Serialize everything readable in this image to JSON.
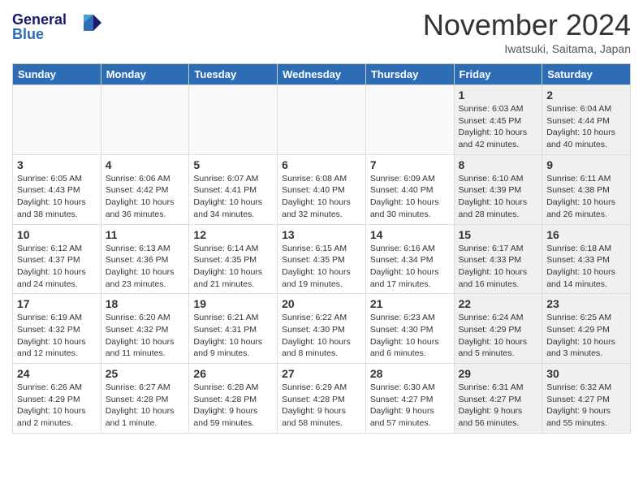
{
  "header": {
    "logo_line1": "General",
    "logo_line2": "Blue",
    "month_title": "November 2024",
    "location": "Iwatsuki, Saitama, Japan"
  },
  "days_of_week": [
    "Sunday",
    "Monday",
    "Tuesday",
    "Wednesday",
    "Thursday",
    "Friday",
    "Saturday"
  ],
  "weeks": [
    [
      {
        "num": "",
        "info": "",
        "empty": true
      },
      {
        "num": "",
        "info": "",
        "empty": true
      },
      {
        "num": "",
        "info": "",
        "empty": true
      },
      {
        "num": "",
        "info": "",
        "empty": true
      },
      {
        "num": "",
        "info": "",
        "empty": true
      },
      {
        "num": "1",
        "info": "Sunrise: 6:03 AM\nSunset: 4:45 PM\nDaylight: 10 hours and 42 minutes.",
        "shaded": true
      },
      {
        "num": "2",
        "info": "Sunrise: 6:04 AM\nSunset: 4:44 PM\nDaylight: 10 hours and 40 minutes.",
        "shaded": true
      }
    ],
    [
      {
        "num": "3",
        "info": "Sunrise: 6:05 AM\nSunset: 4:43 PM\nDaylight: 10 hours and 38 minutes."
      },
      {
        "num": "4",
        "info": "Sunrise: 6:06 AM\nSunset: 4:42 PM\nDaylight: 10 hours and 36 minutes."
      },
      {
        "num": "5",
        "info": "Sunrise: 6:07 AM\nSunset: 4:41 PM\nDaylight: 10 hours and 34 minutes."
      },
      {
        "num": "6",
        "info": "Sunrise: 6:08 AM\nSunset: 4:40 PM\nDaylight: 10 hours and 32 minutes."
      },
      {
        "num": "7",
        "info": "Sunrise: 6:09 AM\nSunset: 4:40 PM\nDaylight: 10 hours and 30 minutes."
      },
      {
        "num": "8",
        "info": "Sunrise: 6:10 AM\nSunset: 4:39 PM\nDaylight: 10 hours and 28 minutes.",
        "shaded": true
      },
      {
        "num": "9",
        "info": "Sunrise: 6:11 AM\nSunset: 4:38 PM\nDaylight: 10 hours and 26 minutes.",
        "shaded": true
      }
    ],
    [
      {
        "num": "10",
        "info": "Sunrise: 6:12 AM\nSunset: 4:37 PM\nDaylight: 10 hours and 24 minutes."
      },
      {
        "num": "11",
        "info": "Sunrise: 6:13 AM\nSunset: 4:36 PM\nDaylight: 10 hours and 23 minutes."
      },
      {
        "num": "12",
        "info": "Sunrise: 6:14 AM\nSunset: 4:35 PM\nDaylight: 10 hours and 21 minutes."
      },
      {
        "num": "13",
        "info": "Sunrise: 6:15 AM\nSunset: 4:35 PM\nDaylight: 10 hours and 19 minutes."
      },
      {
        "num": "14",
        "info": "Sunrise: 6:16 AM\nSunset: 4:34 PM\nDaylight: 10 hours and 17 minutes."
      },
      {
        "num": "15",
        "info": "Sunrise: 6:17 AM\nSunset: 4:33 PM\nDaylight: 10 hours and 16 minutes.",
        "shaded": true
      },
      {
        "num": "16",
        "info": "Sunrise: 6:18 AM\nSunset: 4:33 PM\nDaylight: 10 hours and 14 minutes.",
        "shaded": true
      }
    ],
    [
      {
        "num": "17",
        "info": "Sunrise: 6:19 AM\nSunset: 4:32 PM\nDaylight: 10 hours and 12 minutes."
      },
      {
        "num": "18",
        "info": "Sunrise: 6:20 AM\nSunset: 4:32 PM\nDaylight: 10 hours and 11 minutes."
      },
      {
        "num": "19",
        "info": "Sunrise: 6:21 AM\nSunset: 4:31 PM\nDaylight: 10 hours and 9 minutes."
      },
      {
        "num": "20",
        "info": "Sunrise: 6:22 AM\nSunset: 4:30 PM\nDaylight: 10 hours and 8 minutes."
      },
      {
        "num": "21",
        "info": "Sunrise: 6:23 AM\nSunset: 4:30 PM\nDaylight: 10 hours and 6 minutes."
      },
      {
        "num": "22",
        "info": "Sunrise: 6:24 AM\nSunset: 4:29 PM\nDaylight: 10 hours and 5 minutes.",
        "shaded": true
      },
      {
        "num": "23",
        "info": "Sunrise: 6:25 AM\nSunset: 4:29 PM\nDaylight: 10 hours and 3 minutes.",
        "shaded": true
      }
    ],
    [
      {
        "num": "24",
        "info": "Sunrise: 6:26 AM\nSunset: 4:29 PM\nDaylight: 10 hours and 2 minutes."
      },
      {
        "num": "25",
        "info": "Sunrise: 6:27 AM\nSunset: 4:28 PM\nDaylight: 10 hours and 1 minute."
      },
      {
        "num": "26",
        "info": "Sunrise: 6:28 AM\nSunset: 4:28 PM\nDaylight: 9 hours and 59 minutes."
      },
      {
        "num": "27",
        "info": "Sunrise: 6:29 AM\nSunset: 4:28 PM\nDaylight: 9 hours and 58 minutes."
      },
      {
        "num": "28",
        "info": "Sunrise: 6:30 AM\nSunset: 4:27 PM\nDaylight: 9 hours and 57 minutes."
      },
      {
        "num": "29",
        "info": "Sunrise: 6:31 AM\nSunset: 4:27 PM\nDaylight: 9 hours and 56 minutes.",
        "shaded": true
      },
      {
        "num": "30",
        "info": "Sunrise: 6:32 AM\nSunset: 4:27 PM\nDaylight: 9 hours and 55 minutes.",
        "shaded": true
      }
    ]
  ]
}
